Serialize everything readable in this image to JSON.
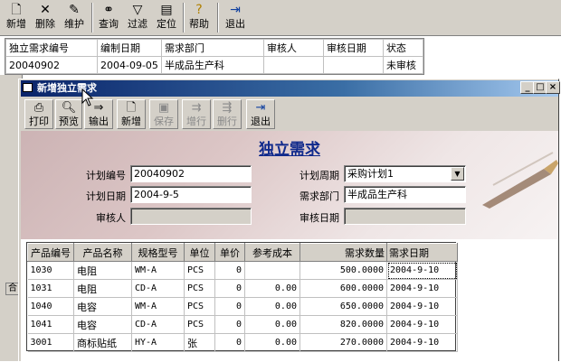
{
  "app": {
    "toolbar": [
      {
        "label": "新增",
        "icon": "new-doc-icon"
      },
      {
        "label": "删除",
        "icon": "delete-x-icon"
      },
      {
        "label": "维护",
        "icon": "edit-icon"
      },
      {
        "label": "查询",
        "icon": "binoculars-icon"
      },
      {
        "label": "过滤",
        "icon": "filter-icon"
      },
      {
        "label": "定位",
        "icon": "locate-icon"
      },
      {
        "label": "帮助",
        "icon": "help-icon"
      },
      {
        "label": "退出",
        "icon": "exit-icon"
      }
    ],
    "list": {
      "columns": [
        "独立需求编号",
        "编制日期",
        "需求部门",
        "审核人",
        "审核日期",
        "状态"
      ],
      "rows": [
        [
          "20040902",
          "2004-09-05",
          "半成品生产科",
          "",
          "",
          "未审核"
        ]
      ]
    },
    "left_tab": "合"
  },
  "dialog": {
    "title": "新增独立需求",
    "window_buttons": [
      "_",
      "□",
      "×"
    ],
    "toolbar": [
      {
        "label": "打印",
        "icon": "printer-icon",
        "enabled": true
      },
      {
        "label": "预览",
        "icon": "preview-icon",
        "enabled": true
      },
      {
        "label": "输出",
        "icon": "export-icon",
        "enabled": true
      },
      {
        "label": "新增",
        "icon": "new-doc-icon",
        "enabled": true
      },
      {
        "label": "保存",
        "icon": "save-icon",
        "enabled": false
      },
      {
        "label": "增行",
        "icon": "add-row-icon",
        "enabled": false
      },
      {
        "label": "删行",
        "icon": "delete-row-icon",
        "enabled": false
      },
      {
        "label": "退出",
        "icon": "exit-icon",
        "enabled": true
      }
    ],
    "form": {
      "title": "独立需求",
      "plan_no_label": "计划编号",
      "plan_no": "20040902",
      "plan_date_label": "计划日期",
      "plan_date": "2004-9-5",
      "reviewer_label": "审核人",
      "reviewer": "",
      "plan_cycle_label": "计划周期",
      "plan_cycle": "采购计划1",
      "dept_label": "需求部门",
      "dept": "半成品生产科",
      "review_date_label": "审核日期",
      "review_date": ""
    },
    "grid": {
      "columns": [
        "产品编号",
        "产品名称",
        "规格型号",
        "单位",
        "单价",
        "参考成本",
        "需求数量",
        "需求日期"
      ],
      "rows": [
        [
          "1030",
          "电阻",
          "WM-A",
          "PCS",
          "0",
          "",
          "500.0000",
          "2004-9-10"
        ],
        [
          "1031",
          "电阻",
          "CD-A",
          "PCS",
          "0",
          "0.00",
          "600.0000",
          "2004-9-10"
        ],
        [
          "1040",
          "电容",
          "WM-A",
          "PCS",
          "0",
          "0.00",
          "650.0000",
          "2004-9-10"
        ],
        [
          "1041",
          "电容",
          "CD-A",
          "PCS",
          "0",
          "0.00",
          "820.0000",
          "2004-9-10"
        ],
        [
          "3001",
          "商标贴纸",
          "HY-A",
          "张",
          "0",
          "0.00",
          "270.0000",
          "2004-9-10"
        ]
      ]
    }
  }
}
